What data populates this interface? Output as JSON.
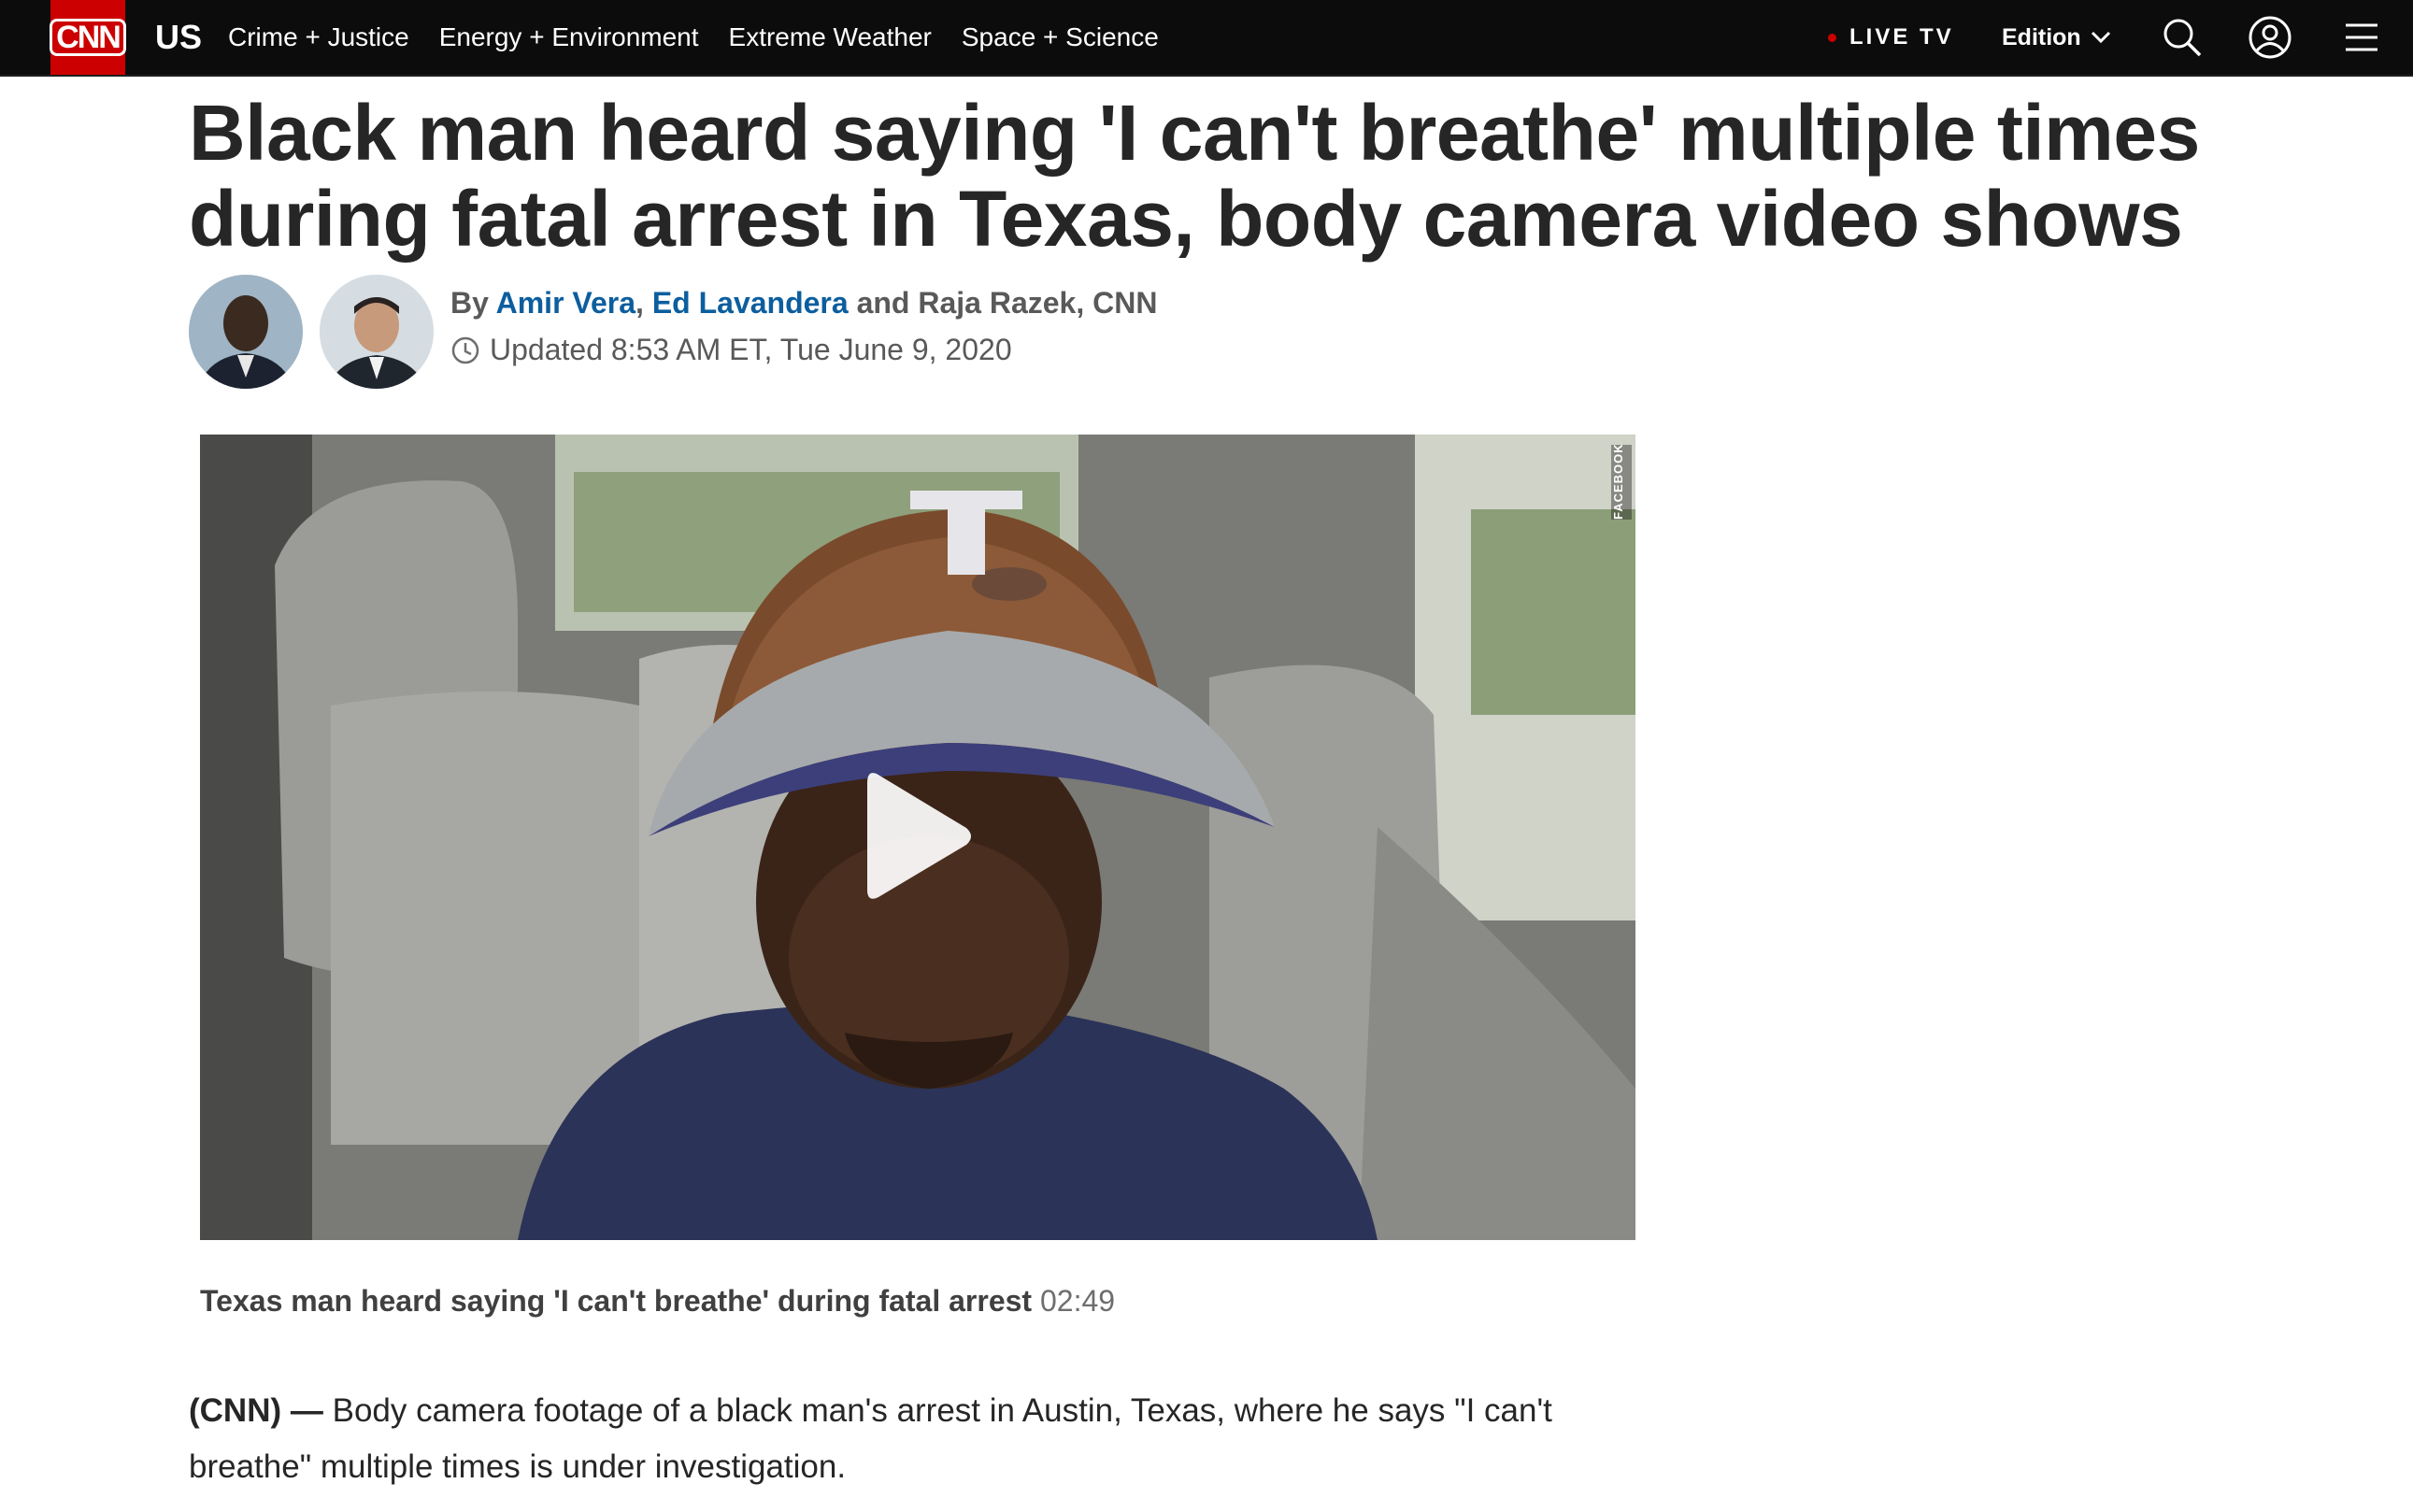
{
  "nav": {
    "logo": "CNN",
    "section": "US",
    "links": [
      "Crime + Justice",
      "Energy + Environment",
      "Extreme Weather",
      "Space + Science"
    ],
    "live_tv": "LIVE TV",
    "edition": "Edition",
    "icons": {
      "search": "search-icon",
      "account": "user-account-icon",
      "menu": "hamburger-menu-icon"
    },
    "colors": {
      "bar": "#0c0c0c",
      "logo": "#cc0000",
      "live_dot": "#cc0000"
    }
  },
  "article": {
    "headline": "Black man heard saying 'I can't breathe' multiple times during fatal arrest in Texas, body camera video shows",
    "byline": {
      "prefix": "By",
      "author1": "Amir Vera",
      "separator": ",",
      "author2": "Ed Lavandera",
      "conjunction": "and Raja Razek, CNN"
    },
    "updated": "Updated 8:53 AM ET, Tue June 9, 2020",
    "video": {
      "watermark": "FACEBOOK",
      "caption_title": "Texas man heard saying 'I can't breathe' during fatal arrest",
      "duration": "02:49"
    },
    "body": {
      "dateline": "(CNN) —",
      "text": "Body camera footage of a black man's arrest in Austin, Texas, where he says \"I can't breathe\" multiple times is under investigation."
    },
    "link_color": "#0c5e9e"
  }
}
